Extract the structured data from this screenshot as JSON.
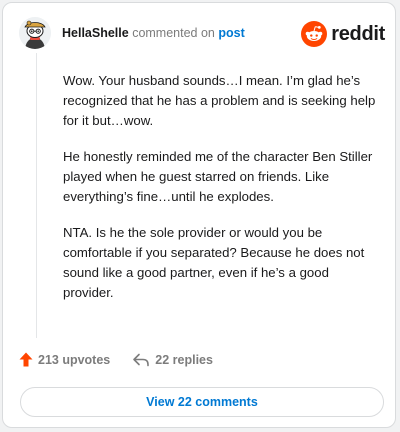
{
  "header": {
    "username": "HellaShelle",
    "action_text": "commented on",
    "post_link": "post"
  },
  "brand": {
    "logo_icon": "reddit-snoo-icon",
    "logo_text": "reddit",
    "color": "#ff4500"
  },
  "comment": {
    "paragraphs": [
      "Wow. Your husband sounds…I mean. I’m glad he’s recognized that he has a problem and is seeking help for it but…wow.",
      "He honestly reminded me of the character Ben Stiller played when he guest starred on friends. Like everything’s fine…until he explodes.",
      "NTA. Is he the sole provider or would you be comfortable if you separated? Because he does not sound like a good partner, even if he’s a good provider."
    ]
  },
  "actions": {
    "upvotes": "213 upvotes",
    "replies": "22 replies",
    "upvote_color": "#ff4500"
  },
  "footer": {
    "view_comments": "View 22 comments",
    "link_color": "#0079d3"
  }
}
